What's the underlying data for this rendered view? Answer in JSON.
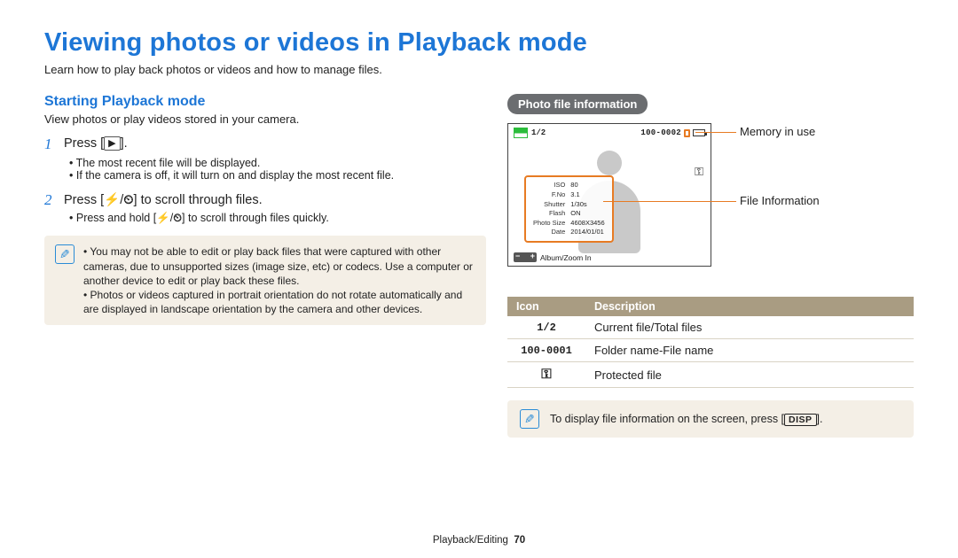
{
  "title": "Viewing photos or videos in Playback mode",
  "intro": "Learn how to play back photos or videos and how to manage files.",
  "left": {
    "subhead": "Starting Playback mode",
    "lead": "View photos or play videos stored in your camera.",
    "step1_prefix": "Press [",
    "step1_suffix": "].",
    "play_glyph": "▶",
    "step1_bullets": [
      "The most recent file will be displayed.",
      "If the camera is off, it will turn on and display the most recent file."
    ],
    "step2_prefix": "Press [",
    "step2_mid": "] to scroll through files.",
    "step2_bullet_prefix": "Press and hold [",
    "step2_bullet_suffix": "] to scroll through files quickly.",
    "flash_glyph": "⚡",
    "timer_glyph": "⏲",
    "notes": [
      "You may not be able to edit or play back files that were captured with other cameras, due to unsupported sizes (image size, etc) or codecs. Use a computer or another device to edit or play back these files.",
      "Photos or videos captured in portrait orientation do not rotate automatically and are displayed in landscape orientation by the camera and other devices."
    ]
  },
  "right": {
    "panel_label": "Photo file information",
    "screen": {
      "counter": "1/2",
      "folderfile": "100-0002",
      "key_glyph": "⚿",
      "info": {
        "r1a": "ISO",
        "r1b": "80",
        "r2a": "F.No",
        "r2b": "3.1",
        "r3a": "Shutter",
        "r3b": "1/30s",
        "r4a": "Flash",
        "r4b": "ON",
        "r5a": "Photo Size",
        "r5b": "4608X3456",
        "r6a": "Date",
        "r6b": "2014/01/01"
      },
      "album_label": "Album/Zoom In"
    },
    "callouts": {
      "mem": "Memory in use",
      "fileinfo": "File Information"
    },
    "table": {
      "h_icon": "Icon",
      "h_desc": "Description",
      "rows": [
        {
          "icon": "1/2",
          "desc": "Current file/Total files"
        },
        {
          "icon": "100-0001",
          "desc": "Folder name-File name"
        },
        {
          "iconGlyph": "⚿",
          "desc": "Protected file"
        }
      ]
    },
    "tip_prefix": "To display file information on the screen, press [",
    "tip_key": "DISP",
    "tip_suffix": "]."
  },
  "footer": {
    "section": "Playback/Editing",
    "page": "70"
  }
}
